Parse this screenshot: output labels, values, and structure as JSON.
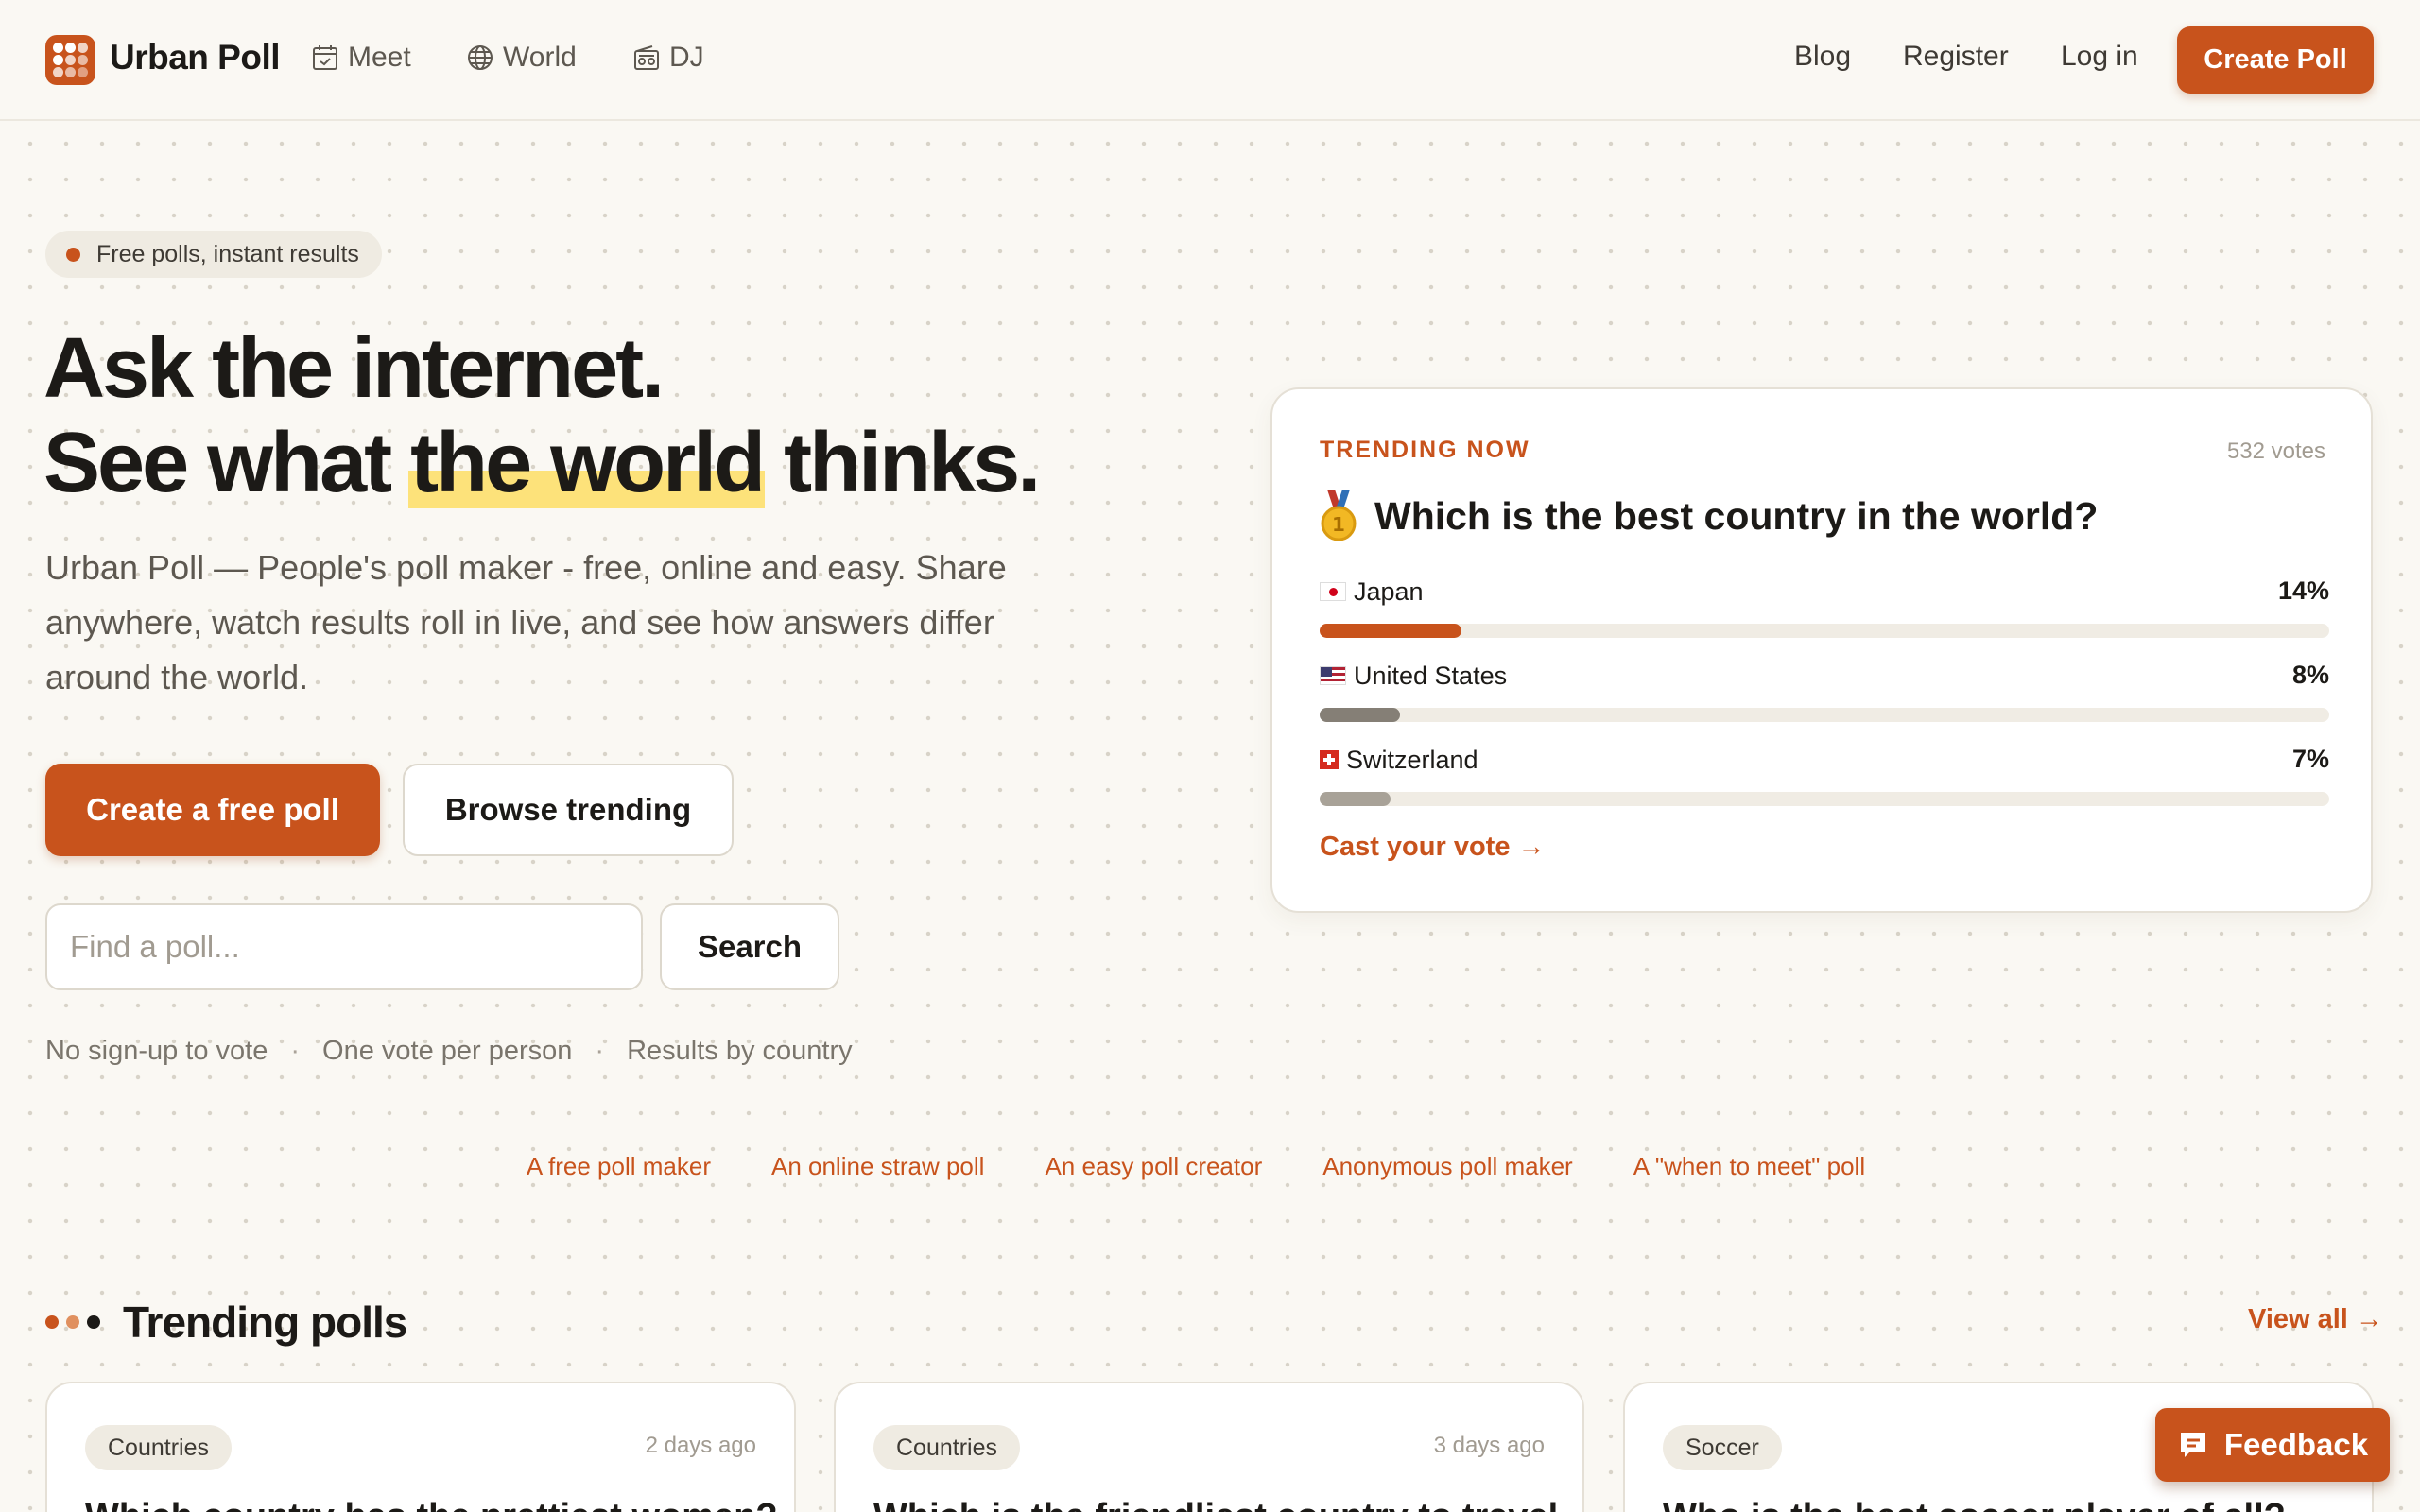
{
  "header": {
    "brand": "Urban Poll",
    "nav": [
      {
        "label": "Meet",
        "icon": "calendar-icon"
      },
      {
        "label": "World",
        "icon": "globe-icon"
      },
      {
        "label": "DJ",
        "icon": "radio-icon"
      }
    ],
    "right_nav": [
      "Blog",
      "Register",
      "Log in"
    ],
    "create_label": "Create Poll"
  },
  "hero": {
    "badge": "Free polls, instant results",
    "headline_line1": "Ask the internet.",
    "headline_pre": "See what ",
    "headline_highlight": "the world",
    "headline_post": " thinks.",
    "lead": "Urban Poll — People's poll maker - free, online and easy. Share anywhere, watch results roll in live, and see how answers differ around the world.",
    "primary_cta": "Create a free poll",
    "secondary_cta": "Browse trending",
    "search_placeholder": "Find a poll...",
    "search_button": "Search",
    "features": [
      "No sign-up to vote",
      "One vote per person",
      "Results by country"
    ]
  },
  "quick_links": [
    "A free poll maker",
    "An online straw poll",
    "An easy poll creator",
    "Anonymous poll maker",
    "A \"when to meet\" poll"
  ],
  "trending_card": {
    "tag": "TRENDING NOW",
    "votes": "532 votes",
    "question": "Which is the best country in the world?",
    "options": [
      {
        "label": "Japan",
        "pct": "14%",
        "value": 14,
        "color": "#c8531c"
      },
      {
        "label": "United States",
        "pct": "8%",
        "value": 8,
        "color": "#857f76"
      },
      {
        "label": "Switzerland",
        "pct": "7%",
        "value": 7,
        "color": "#a8a298"
      }
    ],
    "cast": "Cast your vote →"
  },
  "trending": {
    "title": "Trending polls",
    "view_all": "View all →",
    "polls": [
      {
        "category": "Countries",
        "ago": "2 days ago",
        "title": "Which country has the prettiest women?"
      },
      {
        "category": "Countries",
        "ago": "3 days ago",
        "title": "Which is the friendliest country to travel"
      },
      {
        "category": "Soccer",
        "ago": "",
        "title": "Who is the best soccer player of all?"
      }
    ]
  },
  "feedback_label": "Feedback",
  "colors": {
    "accent": "#c8531c",
    "highlight": "#fde27a",
    "background": "#faf8f3"
  }
}
